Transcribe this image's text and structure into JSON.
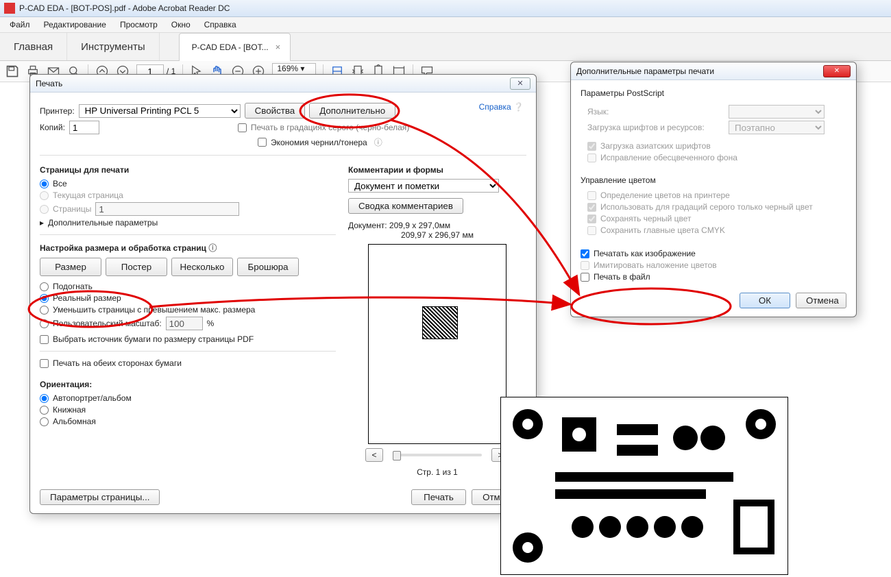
{
  "window": {
    "title": "P-CAD EDA - [BOT-POS].pdf - Adobe Acrobat Reader DC"
  },
  "menubar": [
    "Файл",
    "Редактирование",
    "Просмотр",
    "Окно",
    "Справка"
  ],
  "tabs": {
    "main": [
      "Главная",
      "Инструменты"
    ],
    "doc": "P-CAD EDA - [BOT..."
  },
  "toolbar": {
    "page_current": "1",
    "page_total": "/ 1",
    "zoom": "169%"
  },
  "print": {
    "title": "Печать",
    "printer_label": "Принтер:",
    "printer_value": "HP Universal Printing PCL 5",
    "properties": "Свойства",
    "advanced": "Дополнительно",
    "help": "Справка",
    "copies_label": "Копий:",
    "copies_value": "1",
    "chk_grayscale": "Печать в градациях серого (черно-белая)",
    "chk_save_ink": "Экономия чернил/тонера",
    "pages_title": "Страницы для печати",
    "radio_all": "Все",
    "radio_current": "Текущая страница",
    "radio_range": "Страницы",
    "range_value": "1",
    "more_params": "Дополнительные параметры",
    "size_title": "Настройка размера и обработка страниц",
    "btn_size": "Размер",
    "btn_poster": "Постер",
    "btn_multi": "Несколько",
    "btn_booklet": "Брошюра",
    "radio_fit": "Подогнать",
    "radio_actual": "Реальный размер",
    "radio_shrink": "Уменьшить страницы с превышением макс. размера",
    "radio_custom": "Пользовательский масштаб:",
    "custom_value": "100",
    "custom_pct": "%",
    "chk_paper_source": "Выбрать источник бумаги по размеру страницы PDF",
    "chk_duplex": "Печать на обеих сторонах бумаги",
    "orient_title": "Ориентация:",
    "orient_auto": "Автопортрет/альбом",
    "orient_portrait": "Книжная",
    "orient_landscape": "Альбомная",
    "page_setup": "Параметры страницы...",
    "comments_title": "Комментарии и формы",
    "comments_combo": "Документ и пометки",
    "comments_summary": "Сводка комментариев",
    "doc_dims": "Документ: 209,9 x 297,0мм",
    "preview_dims": "209,97 x 296,97 мм",
    "page_of": "Стр. 1 из 1",
    "btn_print": "Печать",
    "btn_cancel": "Отмена"
  },
  "adv": {
    "title": "Дополнительные параметры печати",
    "ps_title": "Параметры PostScript",
    "lang_label": "Язык:",
    "fonts_label": "Загрузка шрифтов и ресурсов:",
    "fonts_value": "Поэтапно",
    "chk_asian": "Загрузка азиатских шрифтов",
    "chk_bgfix": "Исправление обесцвеченного фона",
    "color_title": "Управление цветом",
    "chk_printer_color": "Определение цветов на принтере",
    "chk_gray_black": "Использовать для градаций серого только черный цвет",
    "chk_keep_black": "Сохранять черный цвет",
    "chk_keep_cmyk": "Сохранить главные цвета CMYK",
    "chk_as_image": "Печатать как изображение",
    "chk_simulate": "Имитировать наложение цветов",
    "chk_to_file": "Печать в файл",
    "btn_ok": "ОК",
    "btn_cancel": "Отмена"
  }
}
